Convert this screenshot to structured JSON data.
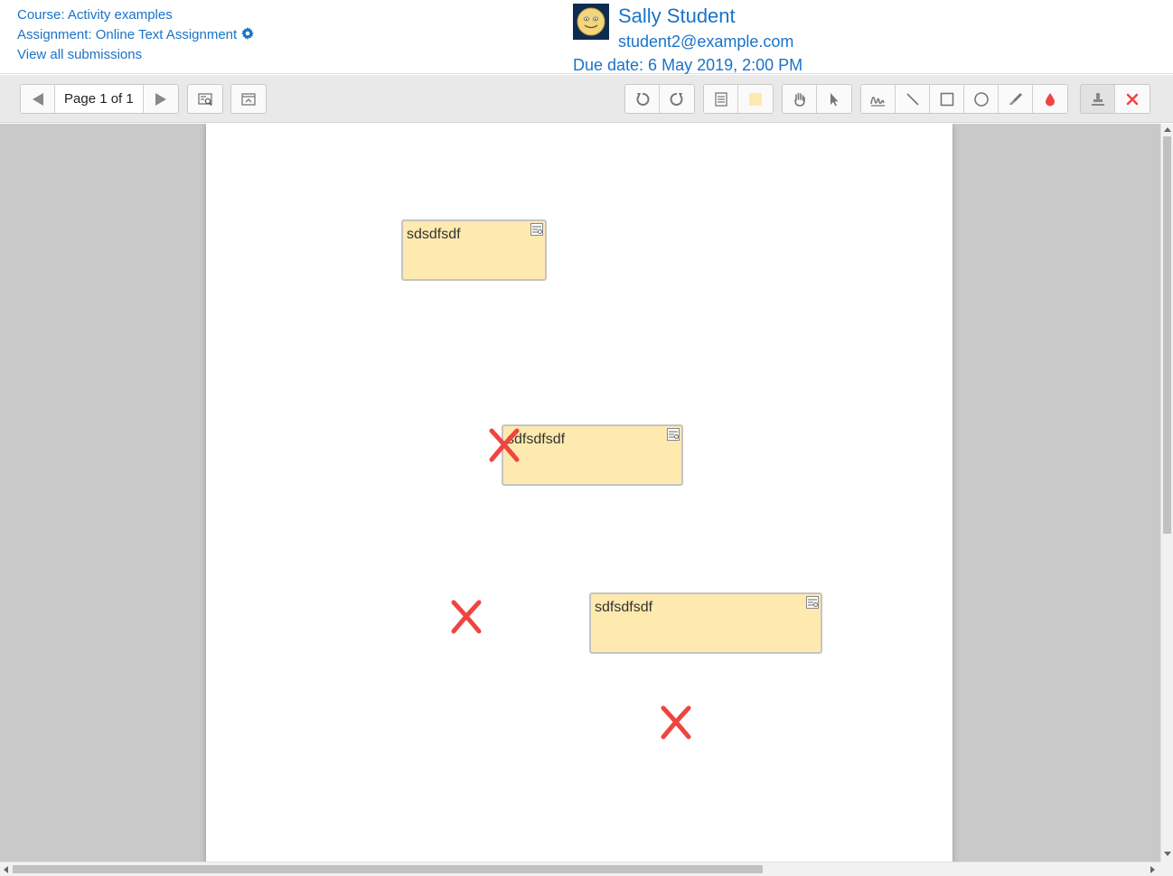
{
  "header": {
    "course_link": "Course: Activity examples",
    "assignment_link": "Assignment: Online Text Assignment",
    "view_all_link": "View all submissions",
    "user": {
      "name": "Sally Student",
      "email": "student2@example.com"
    },
    "due_date": "Due date: 6 May 2019, 2:00 PM"
  },
  "toolbar": {
    "page_label": "Page 1 of 1",
    "icons": {
      "prev": "chevron-left-icon",
      "next": "chevron-right-icon",
      "search_comments": "search-comments-icon",
      "expand": "expand-icon",
      "rotate_left": "rotate-left-icon",
      "rotate_right": "rotate-right-icon",
      "comment": "comment-icon",
      "comment_color": "color-swatch-icon",
      "pan": "hand-icon",
      "select": "pointer-icon",
      "pen": "pen-icon",
      "line": "line-icon",
      "rectangle": "rectangle-icon",
      "oval": "oval-icon",
      "highlight": "highlighter-icon",
      "annotation_color": "drop-icon",
      "stamp": "stamp-icon",
      "stamp_cross": "cross-icon"
    },
    "colors": {
      "comment_swatch": "#fee9ae",
      "annotation_red": "#ef4540"
    }
  },
  "document": {
    "comments": [
      {
        "text": "sdsdfsdf"
      },
      {
        "text": "sdfsdfsdf"
      },
      {
        "text": "sdfsdfsdf"
      }
    ],
    "stamps": [
      "cross-stamp",
      "cross-stamp",
      "cross-stamp"
    ]
  },
  "colors": {
    "link": "#1a73c8",
    "comment_bg": "#fee9ae",
    "stamp_red": "#ef4540"
  }
}
